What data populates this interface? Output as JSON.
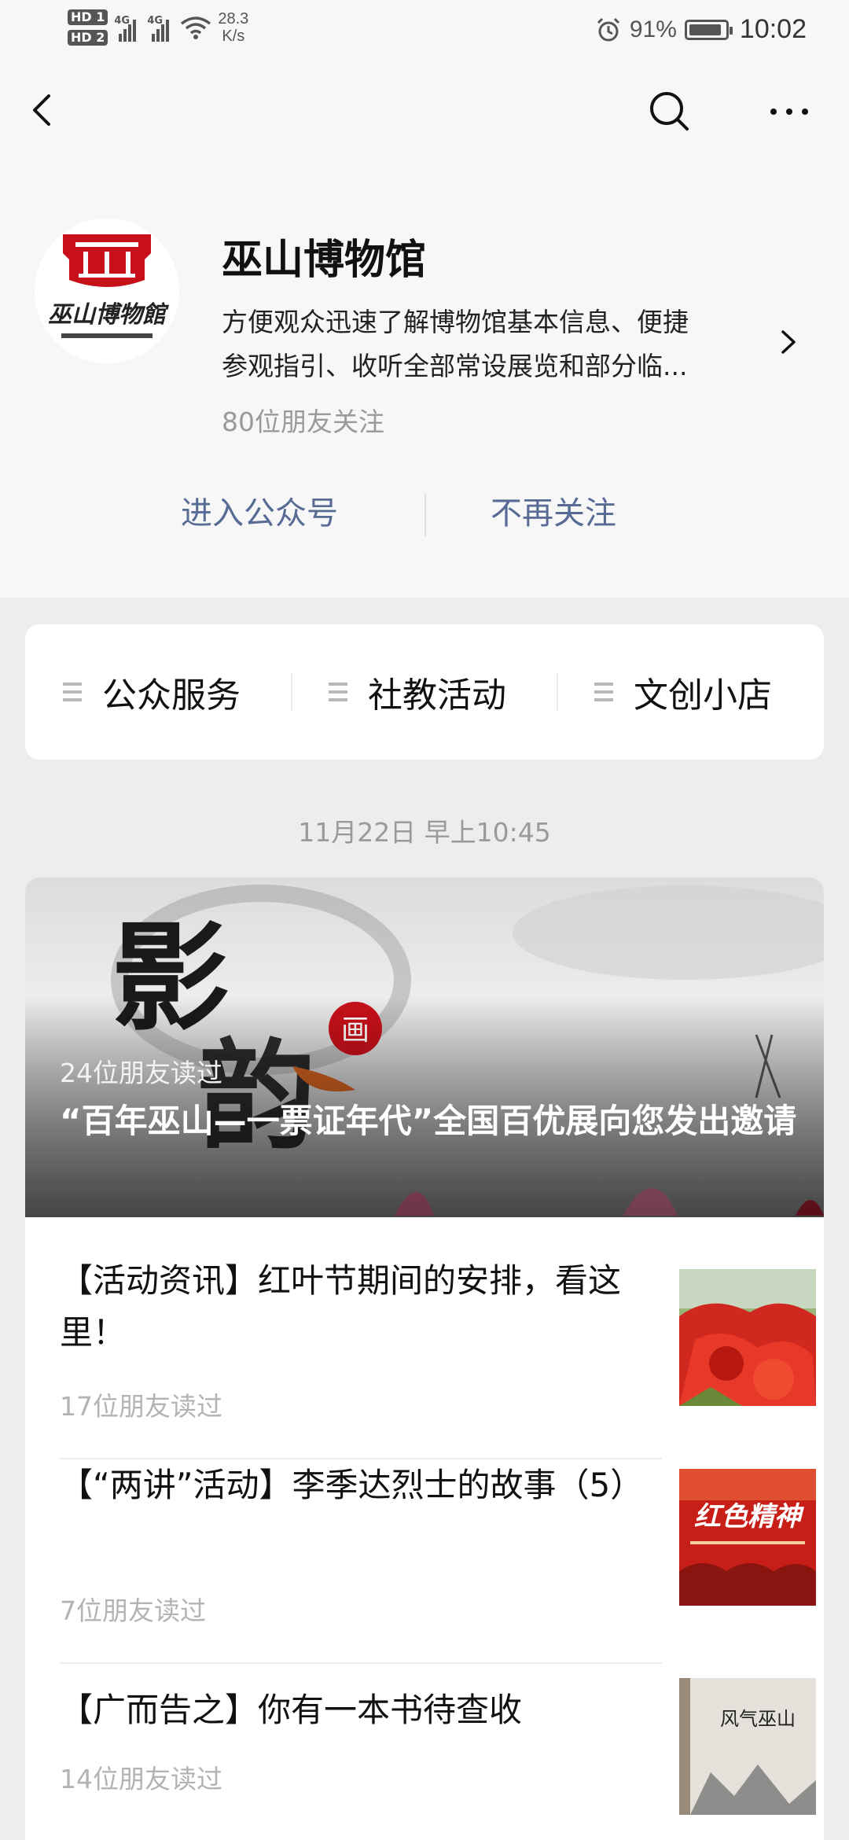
{
  "status_bar": {
    "sim1": "HD 1",
    "sim2": "HD 2",
    "network1": "4G",
    "network2": "4G",
    "speed_value": "28.3",
    "speed_unit": "K/s",
    "battery_percent": "91%",
    "battery_level": 0.91,
    "time": "10:02"
  },
  "nav": {
    "back_icon": "chevron-left-icon",
    "search_icon": "search-icon",
    "more_icon": "more-dots-icon"
  },
  "profile": {
    "name": "巫山博物馆",
    "description_line1": "方便观众迅速了解博物馆基本信息、便捷",
    "description_line2": "参观指引、收听全部常设展览和部分临...",
    "followers": "80位朋友关注",
    "logo_text": "巫山博物館",
    "enter_label": "进入公众号",
    "unfollow_label": "不再关注"
  },
  "menu": {
    "items": [
      {
        "label": "公众服务"
      },
      {
        "label": "社教活动"
      },
      {
        "label": "文创小店"
      }
    ]
  },
  "feed": {
    "date": "11月22日 早上10:45",
    "hero": {
      "reads": "24位朋友读过",
      "title": "“百年巫山—一票证年代”全国百优展向您发出邀请",
      "image_text": "影韵"
    },
    "articles": [
      {
        "title": "【活动资讯】红叶节期间的安排，看这里！",
        "reads": "17位朋友读过"
      },
      {
        "title": "【“两讲”活动】李季达烈士的故事（5）",
        "reads": "7位朋友读过",
        "thumb_text": "红色精神"
      },
      {
        "title": "【广而告之】你有一本书待查收",
        "reads": "14位朋友读过",
        "thumb_text": "风气巫山"
      }
    ]
  },
  "colors": {
    "link": "#576b95",
    "background": "#ededed",
    "secondary_text": "#9a9a9a"
  }
}
